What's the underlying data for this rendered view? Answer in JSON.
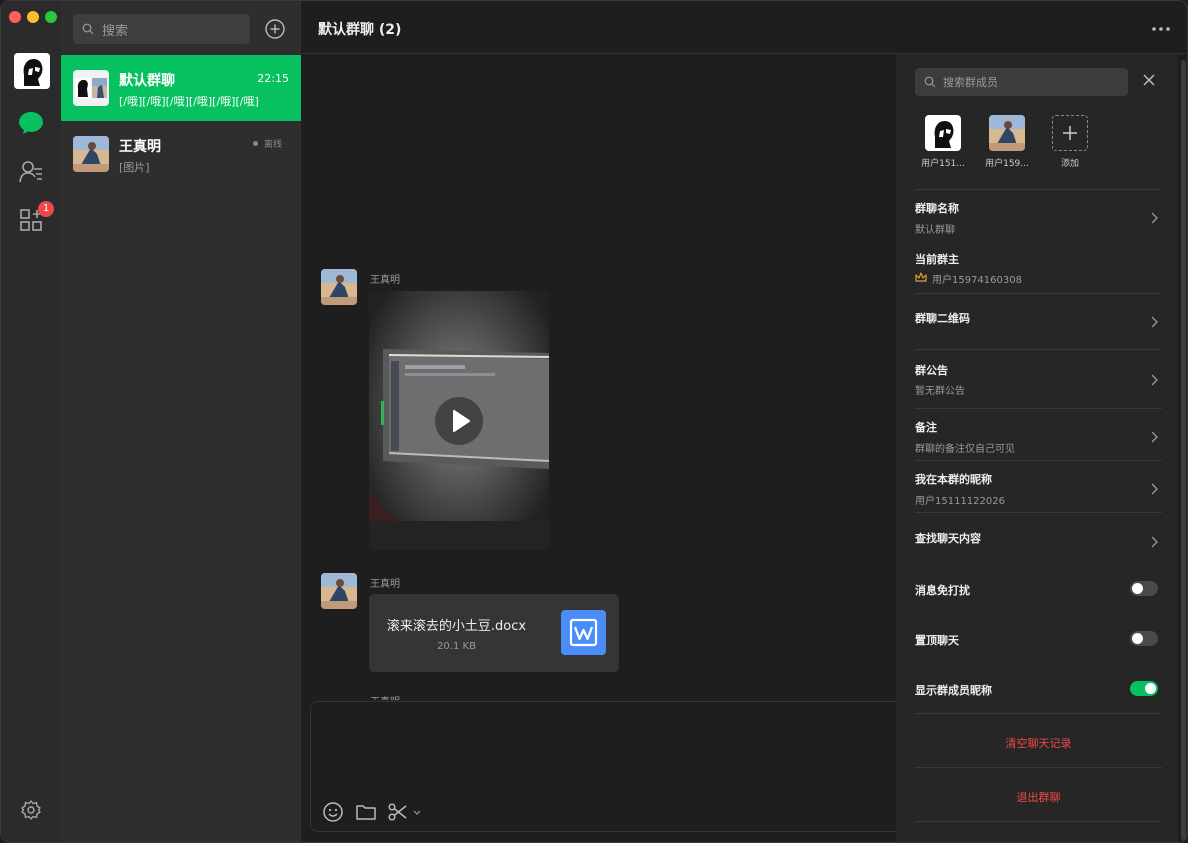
{
  "window": {
    "controls": [
      "close",
      "minimize",
      "maximize"
    ],
    "colors": {
      "close": "#fe5f57",
      "minimize": "#febc2e",
      "maximize": "#28c840"
    }
  },
  "rail": {
    "items": [
      "chat-icon",
      "contacts-icon",
      "apps-icon",
      "settings-icon"
    ],
    "apps_badge": "1",
    "accent": "#07c160"
  },
  "list": {
    "search_placeholder": "搜索",
    "conversations": [
      {
        "name": "默认群聊",
        "time": "22:15",
        "preview": "[/哦][/哦][/哦][/哦][/哦][/哦]",
        "active": true
      },
      {
        "name": "王真明",
        "status": "离线",
        "preview": "[图片]"
      }
    ]
  },
  "chat": {
    "title": "默认群聊 (2)",
    "messages": [
      {
        "sender": "王真明",
        "type": "video"
      },
      {
        "sender": "王真明",
        "type": "file",
        "file_name": "滚来滚去的小土豆.docx",
        "file_size": "20.1 KB"
      },
      {
        "sender": "王真明",
        "type": "partial"
      }
    ],
    "composer_tools": [
      "emoji-icon",
      "folder-icon",
      "scissors-icon",
      "chevron-down-icon"
    ]
  },
  "panel": {
    "search_placeholder": "搜索群成员",
    "members": [
      {
        "name": "用户151..."
      },
      {
        "name": "用户159..."
      }
    ],
    "add_label": "添加",
    "group_name": {
      "label": "群聊名称",
      "value": "默认群聊"
    },
    "owner": {
      "label": "当前群主",
      "value": "用户15974160308"
    },
    "qr": {
      "label": "群聊二维码"
    },
    "notice": {
      "label": "群公告",
      "value": "暂无群公告"
    },
    "remark": {
      "label": "备注",
      "value": "群聊的备注仅自己可见"
    },
    "nickname": {
      "label": "我在本群的昵称",
      "value": "用户15111122026"
    },
    "find": {
      "label": "查找聊天内容"
    },
    "dnd": {
      "label": "消息免打扰",
      "on": false
    },
    "pin": {
      "label": "置顶聊天",
      "on": false
    },
    "show_nick": {
      "label": "显示群成员昵称",
      "on": true
    },
    "clear_label": "清空聊天记录",
    "exit_label": "退出群聊",
    "danger_color": "#f04848"
  }
}
